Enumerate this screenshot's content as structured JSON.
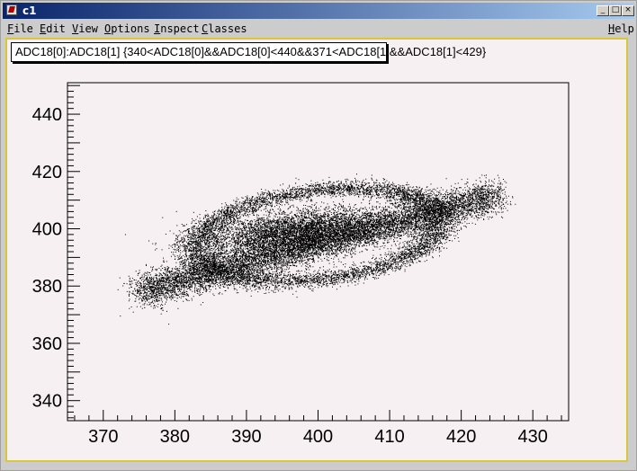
{
  "window": {
    "title": "c1"
  },
  "menu": {
    "items": [
      {
        "label": "File",
        "underline": "F",
        "rest": "ile"
      },
      {
        "label": "Edit",
        "underline": "E",
        "rest": "dit"
      },
      {
        "label": "View",
        "underline": "V",
        "rest": "iew"
      },
      {
        "label": "Options",
        "underline": "O",
        "rest": "ptions"
      },
      {
        "label": "Inspect",
        "underline": "I",
        "rest": "nspect"
      },
      {
        "label": "Classes",
        "underline": "C",
        "rest": "lasses"
      }
    ],
    "help": {
      "label": "Help",
      "underline": "H",
      "rest": "elp"
    }
  },
  "plot": {
    "title": "ADC18[0]:ADC18[1] {340<ADC18[0]&&ADC18[0]<440&&371<ADC18[1]&&ADC18[1]<429}"
  },
  "chart_data": {
    "type": "scatter",
    "title": "ADC18[0]:ADC18[1] {340<ADC18[0]&&ADC18[0]<440&&371<ADC18[1]&&ADC18[1]<429}",
    "xlabel": "",
    "ylabel": "",
    "xlim": [
      365,
      435
    ],
    "ylim": [
      333,
      451
    ],
    "x_ticks": [
      "370",
      "380",
      "390",
      "400",
      "410",
      "420",
      "430"
    ],
    "y_ticks": [
      "340",
      "360",
      "380",
      "400",
      "420",
      "440"
    ],
    "grid": false,
    "point_color": "#000000",
    "background_color": "#f6f0f2",
    "components": [
      {
        "shape": "ring",
        "center": [
          400,
          398
        ],
        "x_radius": 27,
        "y_radius": 30,
        "orientation_deg": 35,
        "density": "medium"
      },
      {
        "shape": "dense-core",
        "center": [
          397,
          399
        ],
        "x_radius": 15,
        "y_radius": 10,
        "orientation_deg": 20,
        "density": "high"
      },
      {
        "shape": "band",
        "from": [
          375,
          378
        ],
        "to": [
          425,
          412
        ],
        "density": "high"
      }
    ]
  }
}
